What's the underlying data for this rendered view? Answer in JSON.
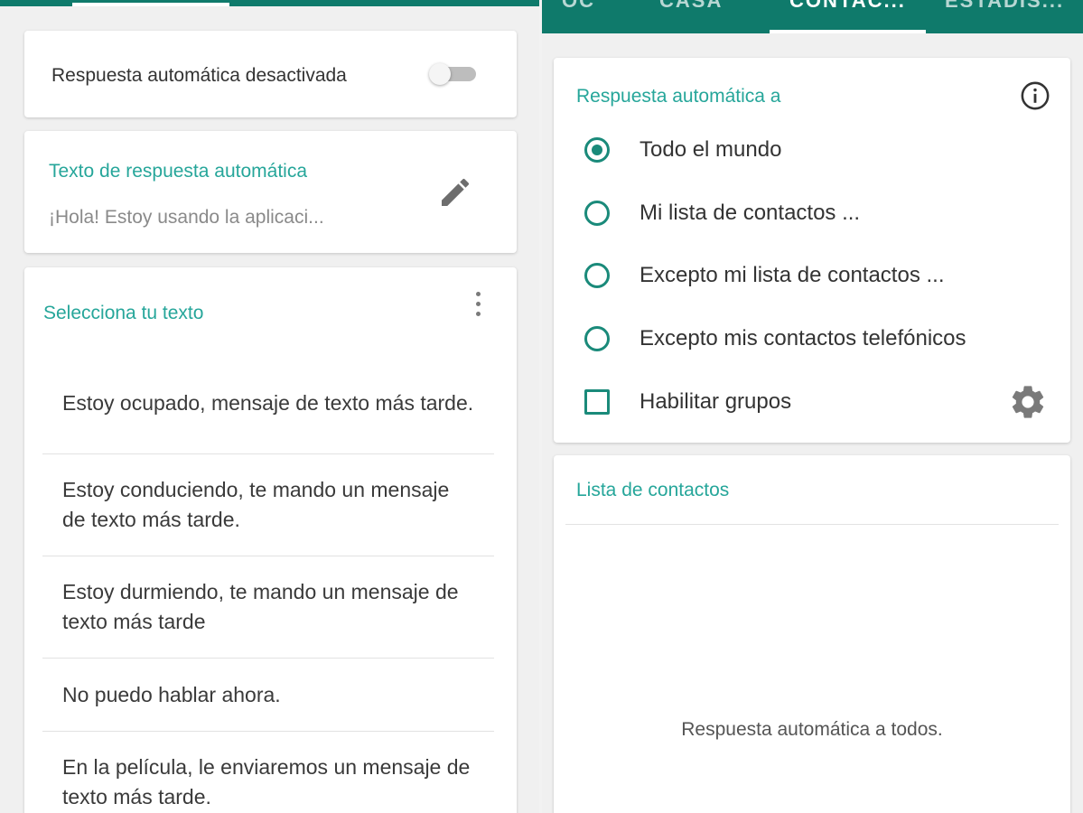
{
  "left": {
    "toggle_card": {
      "label": "Respuesta automática desactivada",
      "enabled": false
    },
    "reply_card": {
      "title": "Texto de respuesta automática",
      "text": "¡Hola! Estoy usando la aplicaci...",
      "edit_icon": "pencil-icon"
    },
    "select_card": {
      "title": "Selecciona tu texto",
      "menu_icon": "more-vertical-icon",
      "messages": [
        "Estoy ocupado, mensaje de texto más tarde.",
        "Estoy conduciendo, te mando un mensaje de texto más tarde.",
        "Estoy durmiendo, te mando un mensaje de texto más tarde",
        "No puedo hablar ahora.",
        "En la película, le enviaremos un mensaje de texto más tarde."
      ]
    }
  },
  "right": {
    "tabs": [
      {
        "label": "OC",
        "active": false
      },
      {
        "label": "CASA",
        "active": false
      },
      {
        "label": "CONTAC...",
        "active": true
      },
      {
        "label": "ESTADÍS...",
        "active": false
      }
    ],
    "audience_card": {
      "title": "Respuesta automática a",
      "info_icon": "info-icon",
      "options": [
        {
          "label": "Todo el mundo",
          "selected": true
        },
        {
          "label": "Mi lista de contactos ...",
          "selected": false
        },
        {
          "label": "Excepto mi lista de contactos ...",
          "selected": false
        },
        {
          "label": "Excepto mis contactos telefónicos",
          "selected": false
        }
      ],
      "groups_label": "Habilitar grupos",
      "groups_checked": false,
      "settings_icon": "gear-icon"
    },
    "contacts_card": {
      "title": "Lista de contactos",
      "empty_text": "Respuesta automática a todos."
    }
  },
  "colors": {
    "app_bar": "#0f7a6b",
    "accent": "#26a69a",
    "control": "#1a8a7a"
  }
}
